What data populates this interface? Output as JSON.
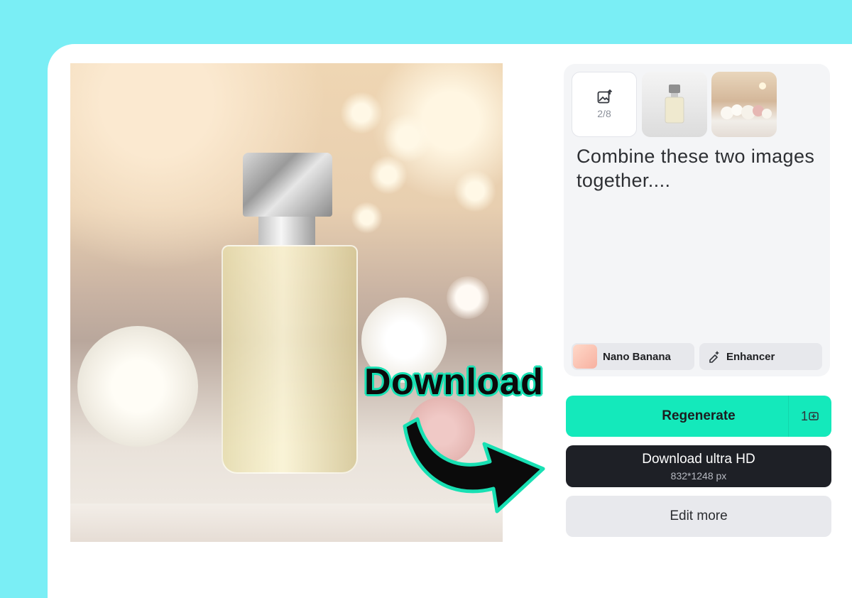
{
  "overlay": {
    "callout": "Download"
  },
  "prompt": {
    "upload_count": "2/8",
    "text": "Combine these two images together....",
    "model_label": "Nano Banana",
    "enhancer_label": "Enhancer"
  },
  "actions": {
    "regenerate_label": "Regenerate",
    "regenerate_credits": "1",
    "download_label": "Download ultra HD",
    "download_resolution": "832*1248 px",
    "edit_label": "Edit more"
  },
  "colors": {
    "background": "#7aeef5",
    "accent": "#14e9bb",
    "download_button": "#1e2026"
  }
}
